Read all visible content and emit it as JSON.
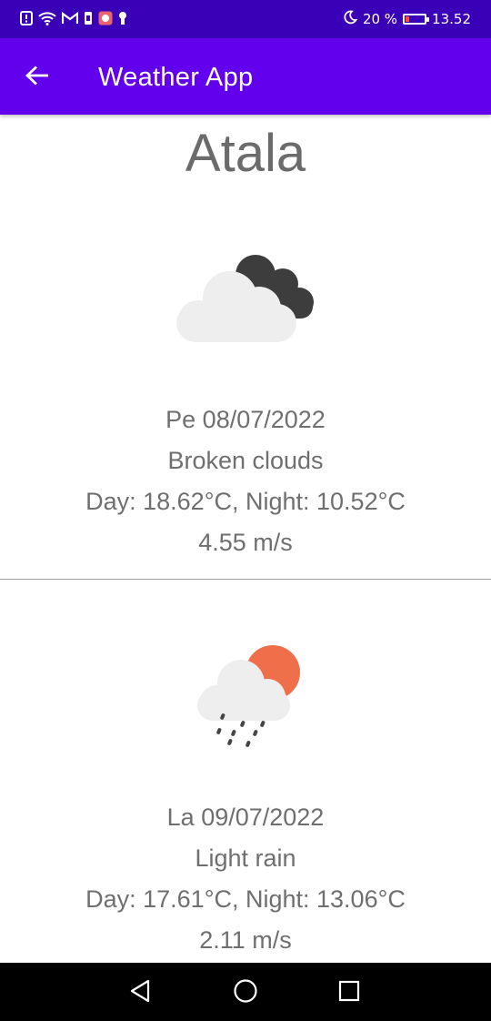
{
  "status_bar": {
    "icons_left": [
      "notification-icon",
      "wifi-icon",
      "gmail-icon",
      "sim-icon",
      "huawei-app-icon",
      "keyhole-icon"
    ],
    "dnd_icon": "moon-icon",
    "battery_text": "20 %",
    "battery_level": 0.2,
    "battery_color": "#ff4a3d",
    "time": "13.52"
  },
  "app_bar": {
    "title": "Weather App",
    "back_icon": "arrow-left-icon",
    "color": "#6200ee"
  },
  "city": "Atala",
  "forecast": [
    {
      "icon": "broken-clouds-icon",
      "date": "Pe 08/07/2022",
      "description": "Broken clouds",
      "temps": "Day: 18.62°C, Night: 10.52°C",
      "wind": "4.55 m/s"
    },
    {
      "icon": "light-rain-icon",
      "date": "La 09/07/2022",
      "description": "Light rain",
      "temps": "Day: 17.61°C, Night: 13.06°C",
      "wind": "2.11 m/s"
    }
  ],
  "nav_bar": {
    "buttons": [
      "back-triangle-icon",
      "home-circle-icon",
      "recents-square-icon"
    ]
  }
}
